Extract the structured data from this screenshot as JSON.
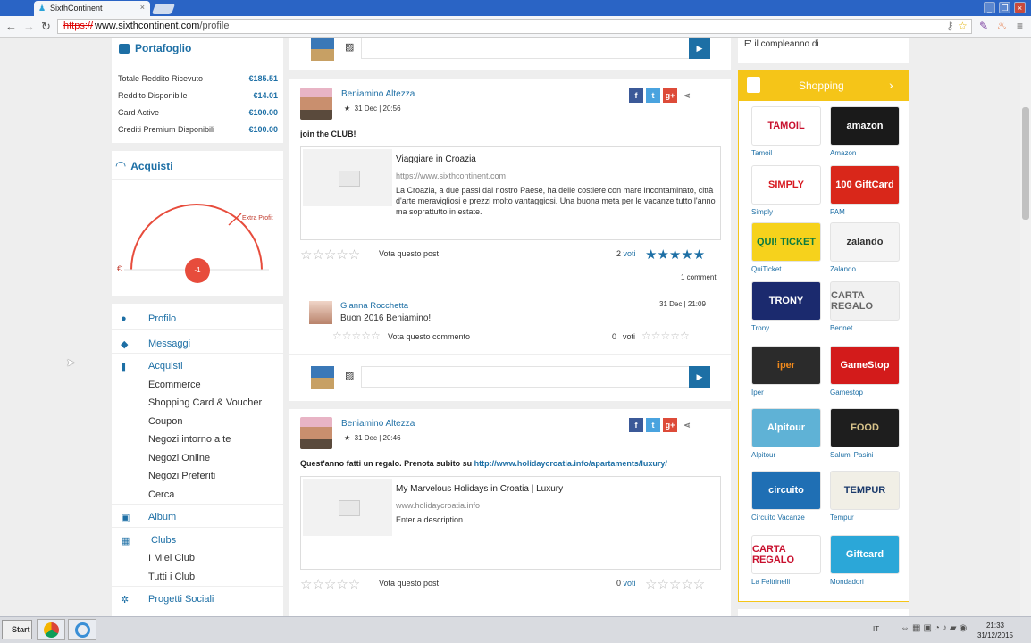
{
  "browser": {
    "tab_title": "SixthContinent",
    "tab_close": "×",
    "url_scheme": "https://",
    "url_host": "www.sixthcontinent.com",
    "url_path": "/profile",
    "window_buttons": [
      "_",
      "❐",
      "×"
    ]
  },
  "portafoglio": {
    "title": "Portafoglio",
    "rows": [
      {
        "label": "Totale Reddito Ricevuto",
        "value": "€185.51"
      },
      {
        "label": "Reddito Disponibile",
        "value": "€14.01"
      },
      {
        "label": "Card Active",
        "value": "€100.00"
      },
      {
        "label": "Crediti Premium Disponibili",
        "value": "€100.00"
      }
    ]
  },
  "acquisti": {
    "title": "Acquisti",
    "gauge_label": "Extra Profit",
    "gauge_value": "-1",
    "currency": "€"
  },
  "menu": {
    "profilo": "Profilo",
    "messaggi": "Messaggi",
    "acquisti": "Acquisti",
    "acquisti_sub": [
      "Ecommerce",
      "Shopping Card & Voucher",
      "Coupon",
      "Negozi intorno a te",
      "Negozi Online",
      "Negozi Preferiti",
      "Cerca"
    ],
    "album": "Album",
    "clubs": "Clubs",
    "clubs_sub": [
      "I Miei Club",
      "Tutti i Club"
    ],
    "progetti": "Progetti Sociali"
  },
  "post1": {
    "author": "Beniamino Altezza",
    "date": "31 Dec | 20:56",
    "text": "join the CLUB!",
    "card_title": "Viaggiare in Croazia",
    "card_url": "https://www.sixthcontinent.com",
    "card_desc": "La Croazia, a due passi dal nostro Paese, ha delle costiere con mare incontaminato, città d'arte meravigliosi e prezzi molto vantaggiosi. Una buona meta per le vacanze tutto l'anno ma soprattutto in estate.",
    "vote_label": "Vota questo post",
    "votes_count": "2",
    "votes_word": "voti",
    "comments_count": "1 commenti",
    "comment_author": "Gianna Rocchetta",
    "comment_text": "Buon 2016 Beniamino!",
    "comment_date": "31 Dec | 21:09",
    "comment_vote_label": "Vota questo commento",
    "comment_votes_count": "0",
    "comment_votes_word": "voti"
  },
  "post2": {
    "author": "Beniamino Altezza",
    "date": "31 Dec | 20:46",
    "text": "Quest'anno fatti un regalo. Prenota subito su",
    "link": "http://www.holidaycroatia.info/apartaments/luxury/",
    "card_title": "My Marvelous Holidays in Croatia | Luxury",
    "card_url": "www.holidaycroatia.info",
    "card_desc": "Enter a description",
    "vote_label": "Vota questo post",
    "votes_count": "0",
    "votes_word": "voti"
  },
  "right": {
    "birthday": "E' il compleanno di",
    "shopping_title": "Shopping",
    "shops": [
      {
        "name": "Tamoil",
        "logo": "TAMOIL",
        "bg": "#ffffff",
        "fg": "#c8102e"
      },
      {
        "name": "Amazon",
        "logo": "amazon",
        "bg": "#1a1a1a",
        "fg": "#ffffff"
      },
      {
        "name": "Simply",
        "logo": "SIMPLY",
        "bg": "#ffffff",
        "fg": "#d71920"
      },
      {
        "name": "PAM",
        "logo": "100 GiftCard",
        "bg": "#d9271a",
        "fg": "#ffffff"
      },
      {
        "name": "QuiTicket",
        "logo": "QUI! TICKET",
        "bg": "#f6d21c",
        "fg": "#0c7b3f"
      },
      {
        "name": "Zalando",
        "logo": "zalando",
        "bg": "#f4f4f4",
        "fg": "#333333"
      },
      {
        "name": "Trony",
        "logo": "TRONY",
        "bg": "#1b2a6e",
        "fg": "#ffffff"
      },
      {
        "name": "Bennet",
        "logo": "CARTA REGALO",
        "bg": "#f1f1f1",
        "fg": "#666666"
      },
      {
        "name": "Iper",
        "logo": "iper",
        "bg": "#2b2b2b",
        "fg": "#f28a1c"
      },
      {
        "name": "Gamestop",
        "logo": "GameStop",
        "bg": "#d31b1b",
        "fg": "#ffffff"
      },
      {
        "name": "Alpitour",
        "logo": "Alpitour",
        "bg": "#5fb2d6",
        "fg": "#ffffff"
      },
      {
        "name": "Salumi Pasini",
        "logo": "FOOD",
        "bg": "#1e1e1e",
        "fg": "#d8c38a"
      },
      {
        "name": "Circuito Vacanze",
        "logo": "circuito",
        "bg": "#1f6fb4",
        "fg": "#ffffff"
      },
      {
        "name": "Tempur",
        "logo": "TEMPUR",
        "bg": "#f1efe6",
        "fg": "#1b3a6b"
      },
      {
        "name": "La Feltrinelli",
        "logo": "CARTA REGALO",
        "bg": "#ffffff",
        "fg": "#c8102e"
      },
      {
        "name": "Mondadori",
        "logo": "Giftcard",
        "bg": "#2ba7d8",
        "fg": "#ffffff"
      }
    ]
  },
  "taskbar": {
    "start": "Start",
    "lang": "IT",
    "time": "21:33",
    "date": "31/12/2015"
  }
}
